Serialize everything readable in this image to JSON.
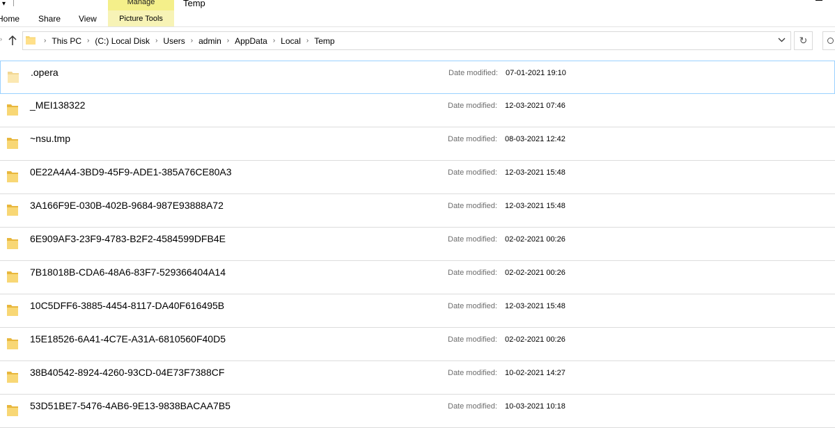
{
  "ribbon": {
    "tabs": [
      "Home",
      "Share",
      "View"
    ],
    "context_group_label": "Manage",
    "context_tab_label": "Picture Tools",
    "window_title": "Temp"
  },
  "address": {
    "crumbs": [
      "This PC",
      "(C:) Local Disk",
      "Users",
      "admin",
      "AppData",
      "Local",
      "Temp"
    ]
  },
  "colors": {
    "context_header": "#f4ef8a",
    "context_tab": "#f7f3b6",
    "selection_border": "#99d1ff",
    "folder_yellow": "#f8d775"
  },
  "files": {
    "date_label": "Date modified:",
    "items": [
      {
        "name": ".opera",
        "date": "07-01-2021 19:10",
        "selected": true,
        "faded": true
      },
      {
        "name": "_MEI138322",
        "date": "12-03-2021 07:46"
      },
      {
        "name": "~nsu.tmp",
        "date": "08-03-2021 12:42"
      },
      {
        "name": "0E22A4A4-3BD9-45F9-ADE1-385A76CE80A3",
        "date": "12-03-2021 15:48"
      },
      {
        "name": "3A166F9E-030B-402B-9684-987E93888A72",
        "date": "12-03-2021 15:48"
      },
      {
        "name": "6E909AF3-23F9-4783-B2F2-4584599DFB4E",
        "date": "02-02-2021 00:26"
      },
      {
        "name": "7B18018B-CDA6-48A6-83F7-529366404A14",
        "date": "02-02-2021 00:26"
      },
      {
        "name": "10C5DFF6-3885-4454-8117-DA40F616495B",
        "date": "12-03-2021 15:48"
      },
      {
        "name": "15E18526-6A41-4C7E-A31A-6810560F40D5",
        "date": "02-02-2021 00:26"
      },
      {
        "name": "38B40542-8924-4260-93CD-04E73F7388CF",
        "date": "10-02-2021 14:27"
      },
      {
        "name": "53D51BE7-5476-4AB6-9E13-9838BACAA7B5",
        "date": "10-03-2021 10:18"
      }
    ]
  }
}
